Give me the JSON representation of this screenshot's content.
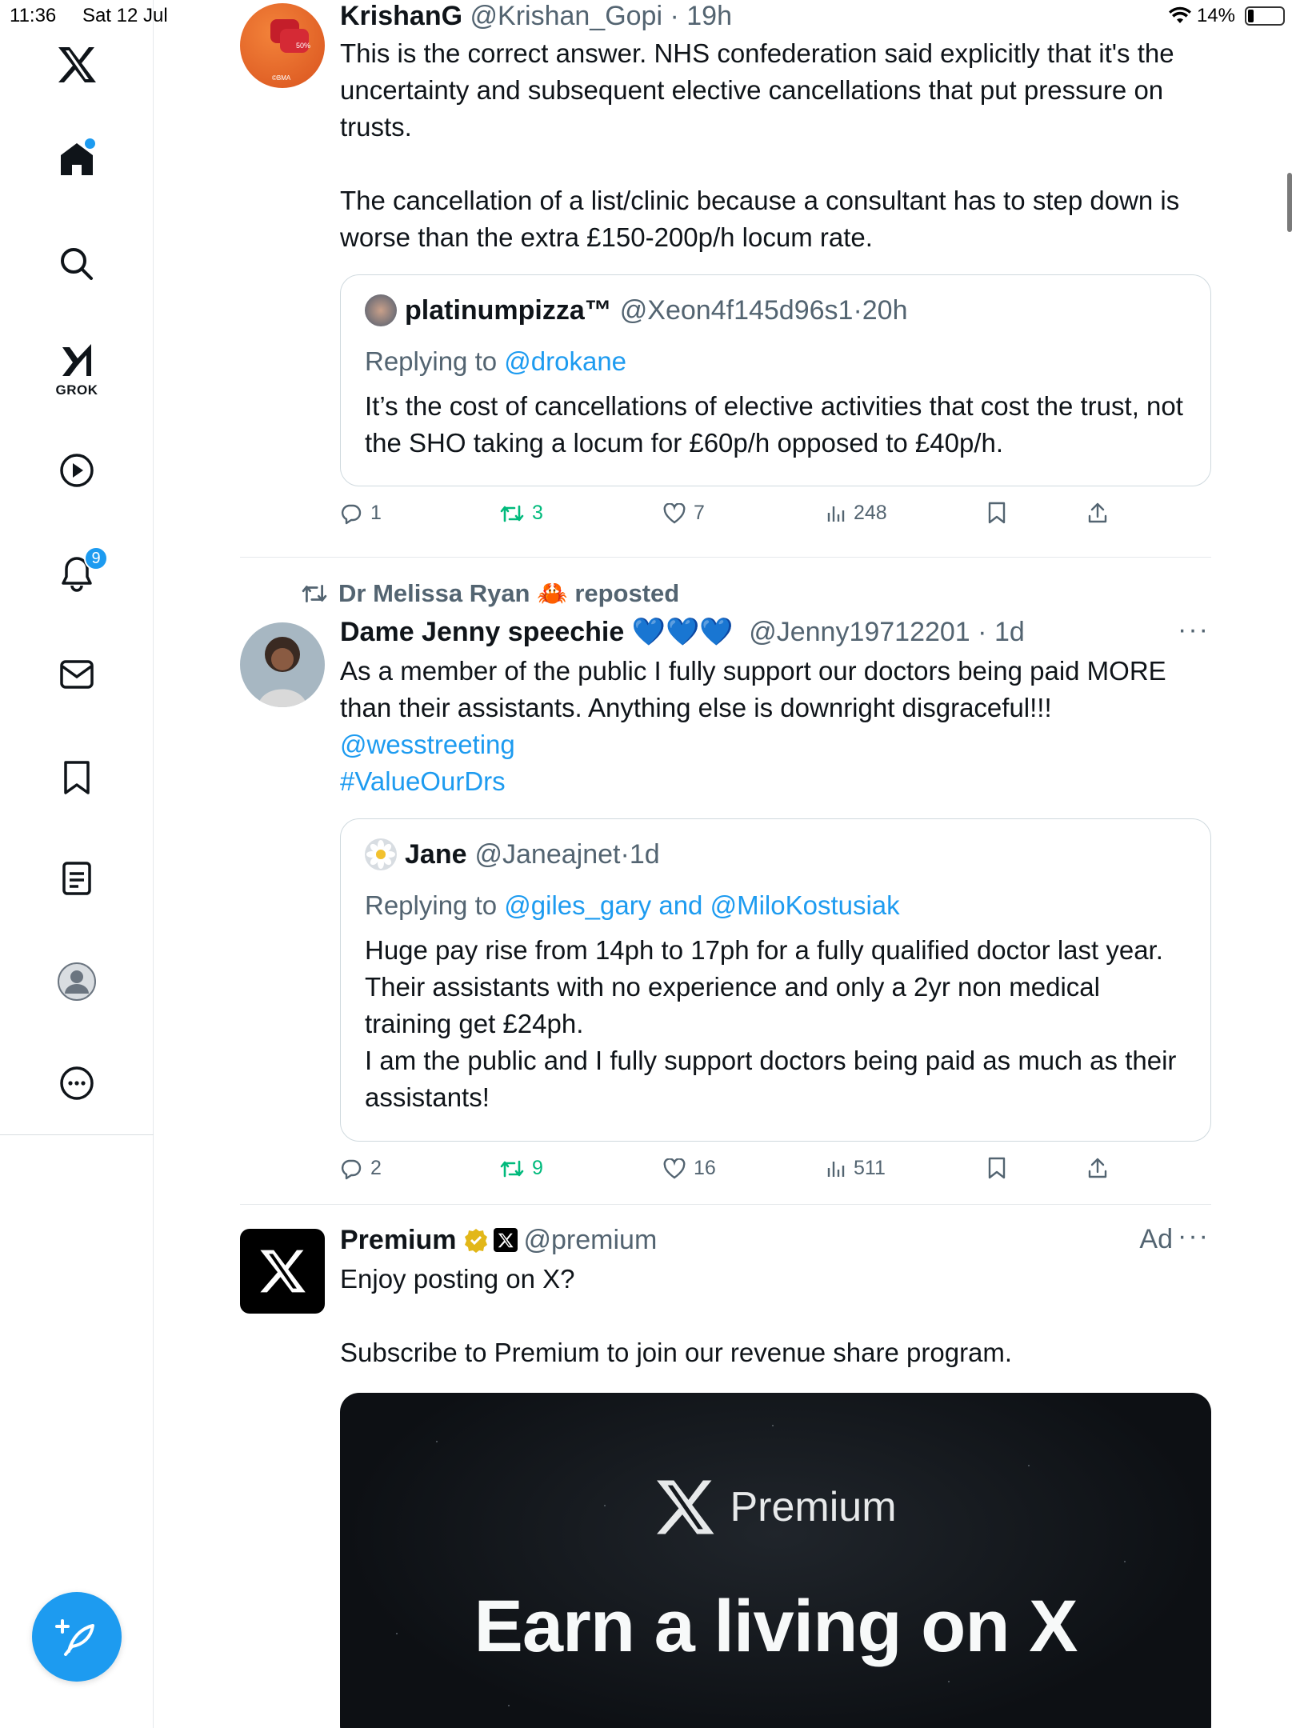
{
  "status_bar": {
    "time": "11:36",
    "date": "Sat 12 Jul",
    "battery": "14%"
  },
  "sidebar": {
    "grok_label": "GROK",
    "notifications_badge": "9"
  },
  "tweets": [
    {
      "name": "KrishanG",
      "handle": "@Krishan_Gopi",
      "time": "19h",
      "text": "This is the correct answer. NHS confederation said explicitly that it's the uncertainty and subsequent elective cancellations that put pressure on trusts.\n\nThe cancellation of a list/clinic because a consultant has to step down is worse than the extra £150-200p/h locum rate.",
      "quote": {
        "name": "platinumpizza™",
        "handle": "@Xeon4f145d96s1",
        "time": "20h",
        "replying_prefix": "Replying to ",
        "replying_to": "@drokane",
        "text": "It’s the cost of cancellations of elective activities that cost the trust, not the SHO taking a locum for £60p/h opposed to £40p/h."
      },
      "actions": {
        "replies": "1",
        "reposts": "3",
        "likes": "7",
        "views": "248"
      }
    },
    {
      "reposted_by": "Dr Melissa Ryan 🦀 reposted",
      "name": "Dame Jenny speechie 💙💙💙",
      "handle": "@Jenny19712201",
      "time": "1d",
      "text": "As a member of the public I fully support our doctors being paid MORE than their assistants. Anything else is downright disgraceful!!!",
      "mention": "@wesstreeting",
      "hashtag": "#ValueOurDrs",
      "quote": {
        "name": "Jane",
        "handle": "@Janeajnet",
        "time": "1d",
        "replying_prefix": "Replying to ",
        "replying_to": "@giles_gary and @MiloKostusiak",
        "text": "Huge pay rise from 14ph to 17ph for a fully qualified doctor last year. Their assistants with no experience and only a 2yr non medical training get £24ph.\nI am the public and I fully support doctors being paid as much as their assistants!"
      },
      "actions": {
        "replies": "2",
        "reposts": "9",
        "likes": "16",
        "views": "511"
      }
    },
    {
      "name": "Premium",
      "handle": "@premium",
      "ad_label": "Ad",
      "text": "Enjoy posting on X?\n\nSubscribe to Premium to join our revenue share program.",
      "promo_brand": "Premium",
      "promo_headline": "Earn a living on X"
    }
  ],
  "colors": {
    "accent": "#1d9bf0",
    "repost_green": "#00ba7c",
    "muted": "#536471",
    "border": "#cfd9de"
  },
  "icons": [
    "x-logo-icon",
    "home-icon",
    "search-icon",
    "grok-icon",
    "video-icon",
    "bell-icon",
    "mail-icon",
    "bookmark-icon",
    "lists-icon",
    "profile-icon",
    "more-icon",
    "compose-icon",
    "reply-icon",
    "repost-icon",
    "like-icon",
    "views-icon",
    "share-icon",
    "verified-badge-icon",
    "wifi-icon",
    "battery-icon"
  ]
}
